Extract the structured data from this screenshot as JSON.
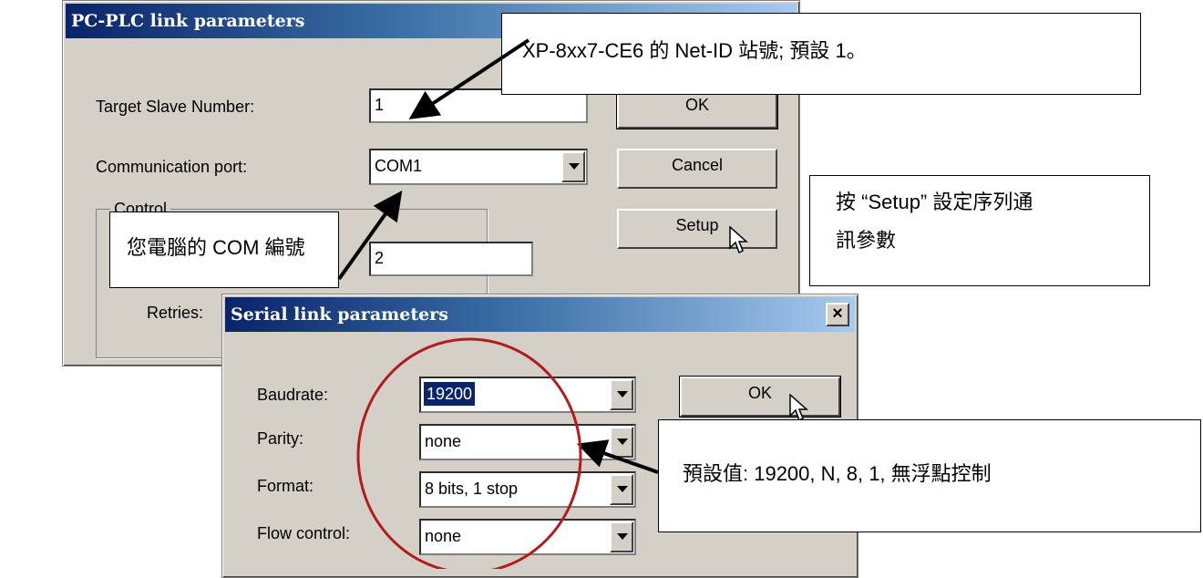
{
  "plc_dialog": {
    "title": "PC-PLC link parameters",
    "target_label": "Target Slave Number:",
    "target_value": "1",
    "port_label": "Communication port:",
    "port_value": "COM1",
    "group_label": "Control",
    "timeout_value": "2",
    "retries_label": "Retries:",
    "ok_label": "OK",
    "cancel_label": "Cancel",
    "setup_label": "Setup"
  },
  "serial_dialog": {
    "title": "Serial link parameters",
    "close_label": "×",
    "baudrate_label": "Baudrate:",
    "baudrate_value": "19200",
    "parity_label": "Parity:",
    "parity_value": "none",
    "format_label": "Format:",
    "format_value": "8 bits, 1 stop",
    "flow_label": "Flow control:",
    "flow_value": "none",
    "ok_label": "OK"
  },
  "callouts": {
    "net_id": "XP-8xx7-CE6 的 Net-ID 站號; 預設 1。",
    "com": "您電腦的 COM 編號",
    "setup_line1": "按 “Setup” 設定序列通",
    "setup_line2": "訊參數",
    "defaults": "預設值: 19200, N, 8, 1, 無浮點控制"
  },
  "colors": {
    "titlebar_start": "#0a246a",
    "titlebar_end": "#a6caf0",
    "circle": "#b31b1b"
  }
}
